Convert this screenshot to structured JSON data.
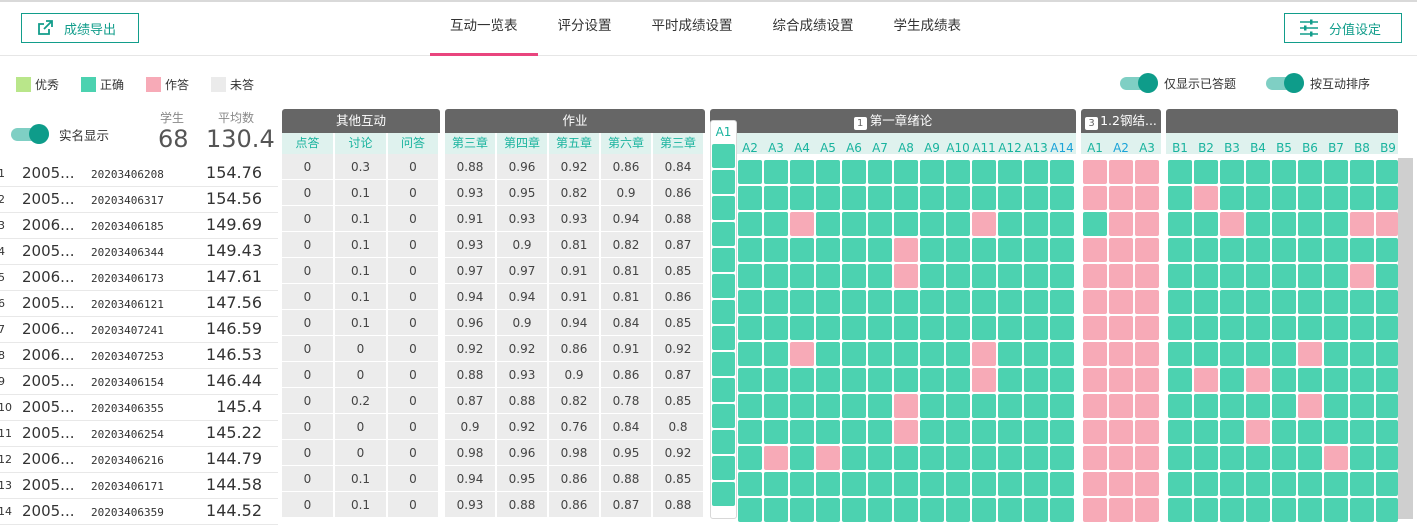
{
  "toolbar": {
    "export_label": "成绩导出",
    "score_label": "分值设定"
  },
  "tabs": [
    {
      "label": "互动一览表",
      "active": true
    },
    {
      "label": "评分设置",
      "active": false
    },
    {
      "label": "平时成绩设置",
      "active": false
    },
    {
      "label": "综合成绩设置",
      "active": false
    },
    {
      "label": "学生成绩表",
      "active": false
    }
  ],
  "legend": [
    {
      "label": "优秀",
      "color": "#b9e68a"
    },
    {
      "label": "正确",
      "color": "#4cd2b0"
    },
    {
      "label": "作答",
      "color": "#f7aab7"
    },
    {
      "label": "未答",
      "color": "#ebebeb"
    }
  ],
  "toggles": {
    "answered_only": "仅显示已答题",
    "sort_by_interaction": "按互动排序",
    "real_name": "实名显示"
  },
  "stats": {
    "students_label": "学生",
    "students_value": "68",
    "average_label": "平均数",
    "average_value": "130.4"
  },
  "groups": {
    "other": {
      "title": "其他互动",
      "cols": [
        "点答",
        "讨论",
        "问答"
      ]
    },
    "homework": {
      "title": "作业",
      "cols": [
        "第三章",
        "第四章",
        "第五章",
        "第六章",
        "第三章"
      ]
    },
    "ch1": {
      "badge": "1",
      "title": "第一章绪论",
      "first": "A1",
      "cols": [
        "A2",
        "A3",
        "A4",
        "A5",
        "A6",
        "A7",
        "A8",
        "A9",
        "A10",
        "A11",
        "A12",
        "A13",
        "A14"
      ]
    },
    "ch3": {
      "badge": "3",
      "title": "1.2钢结...",
      "cols": [
        "A1",
        "A2",
        "A3"
      ]
    },
    "chB": {
      "cols": [
        "B1",
        "B2",
        "B3",
        "B4",
        "B5",
        "B6",
        "B7",
        "B8",
        "B9"
      ]
    }
  },
  "students": [
    {
      "idx": "1",
      "name": "2005...",
      "sid": "20203406208",
      "avg": "154.76",
      "other": [
        "0",
        "0.3",
        "0"
      ],
      "hw": [
        "0.88",
        "0.96",
        "0.92",
        "0.86",
        "0.84"
      ]
    },
    {
      "idx": "2",
      "name": "2005...",
      "sid": "20203406317",
      "avg": "154.56",
      "other": [
        "0",
        "0.1",
        "0"
      ],
      "hw": [
        "0.93",
        "0.95",
        "0.82",
        "0.9",
        "0.86"
      ]
    },
    {
      "idx": "3",
      "name": "2006...",
      "sid": "20203406185",
      "avg": "149.69",
      "other": [
        "0",
        "0.1",
        "0"
      ],
      "hw": [
        "0.91",
        "0.93",
        "0.93",
        "0.94",
        "0.88"
      ]
    },
    {
      "idx": "4",
      "name": "2005...",
      "sid": "20203406344",
      "avg": "149.43",
      "other": [
        "0",
        "0.1",
        "0"
      ],
      "hw": [
        "0.93",
        "0.9",
        "0.81",
        "0.82",
        "0.87"
      ]
    },
    {
      "idx": "5",
      "name": "2006...",
      "sid": "20203406173",
      "avg": "147.61",
      "other": [
        "0",
        "0.1",
        "0"
      ],
      "hw": [
        "0.97",
        "0.97",
        "0.91",
        "0.81",
        "0.85"
      ]
    },
    {
      "idx": "6",
      "name": "2005...",
      "sid": "20203406121",
      "avg": "147.56",
      "other": [
        "0",
        "0.1",
        "0"
      ],
      "hw": [
        "0.94",
        "0.94",
        "0.91",
        "0.81",
        "0.86"
      ]
    },
    {
      "idx": "7",
      "name": "2006...",
      "sid": "20203407241",
      "avg": "146.59",
      "other": [
        "0",
        "0.1",
        "0"
      ],
      "hw": [
        "0.96",
        "0.9",
        "0.94",
        "0.84",
        "0.85"
      ]
    },
    {
      "idx": "8",
      "name": "2006...",
      "sid": "20203407253",
      "avg": "146.53",
      "other": [
        "0",
        "0",
        "0"
      ],
      "hw": [
        "0.92",
        "0.92",
        "0.86",
        "0.91",
        "0.92"
      ]
    },
    {
      "idx": "9",
      "name": "2005...",
      "sid": "20203406154",
      "avg": "146.44",
      "other": [
        "0",
        "0",
        "0"
      ],
      "hw": [
        "0.88",
        "0.93",
        "0.9",
        "0.86",
        "0.87"
      ]
    },
    {
      "idx": "10",
      "name": "2005...",
      "sid": "20203406355",
      "avg": "145.4",
      "other": [
        "0",
        "0.2",
        "0"
      ],
      "hw": [
        "0.87",
        "0.88",
        "0.82",
        "0.78",
        "0.85"
      ]
    },
    {
      "idx": "11",
      "name": "2005...",
      "sid": "20203406254",
      "avg": "145.22",
      "other": [
        "0",
        "0",
        "0"
      ],
      "hw": [
        "0.9",
        "0.92",
        "0.76",
        "0.84",
        "0.8"
      ]
    },
    {
      "idx": "12",
      "name": "2006...",
      "sid": "20203406216",
      "avg": "144.79",
      "other": [
        "0",
        "0",
        "0"
      ],
      "hw": [
        "0.98",
        "0.96",
        "0.98",
        "0.95",
        "0.92"
      ]
    },
    {
      "idx": "13",
      "name": "2005...",
      "sid": "20203406171",
      "avg": "144.58",
      "other": [
        "0",
        "0.1",
        "0"
      ],
      "hw": [
        "0.94",
        "0.95",
        "0.86",
        "0.88",
        "0.85"
      ]
    },
    {
      "idx": "14",
      "name": "2005...",
      "sid": "20203406359",
      "avg": "144.52",
      "other": [
        "0",
        "0.1",
        "0"
      ],
      "hw": [
        "0.93",
        "0.88",
        "0.86",
        "0.87",
        "0.88"
      ]
    }
  ],
  "answer_grid": {
    "legend": "g = correct, p = answered",
    "ch1": [
      "gggggggggggggg",
      "gggggggggggggg",
      "gggpggggggpggg",
      "gggggggpgggggg",
      "gggggggpgggggg",
      "gggggggggggggg",
      "gggggggggggggg",
      "gggpggggggpggg",
      "ggggggggggpggg",
      "gggggggpgggggg",
      "gggggggpgggggg",
      "ggpgpggggggggg",
      "gggggggggggggg",
      "gggggggggggggg"
    ],
    "ch3": [
      "ppp",
      "ppp",
      "gpp",
      "ppp",
      "ppp",
      "ppp",
      "ppp",
      "ppp",
      "ppp",
      "ppp",
      "ppp",
      "ppp",
      "ppp",
      "ppp"
    ],
    "chB": [
      "ggggggggg",
      "gpggggggg",
      "ggpggggpp",
      "ggggggggg",
      "gggggggpg",
      "gggggggggg",
      "ggggggggg",
      "gggggpggg",
      "gpgpggggg",
      "gggggpggg",
      "gggpggggg",
      "ggggggpgg",
      "ggggggggg",
      "ggggggggg"
    ]
  }
}
